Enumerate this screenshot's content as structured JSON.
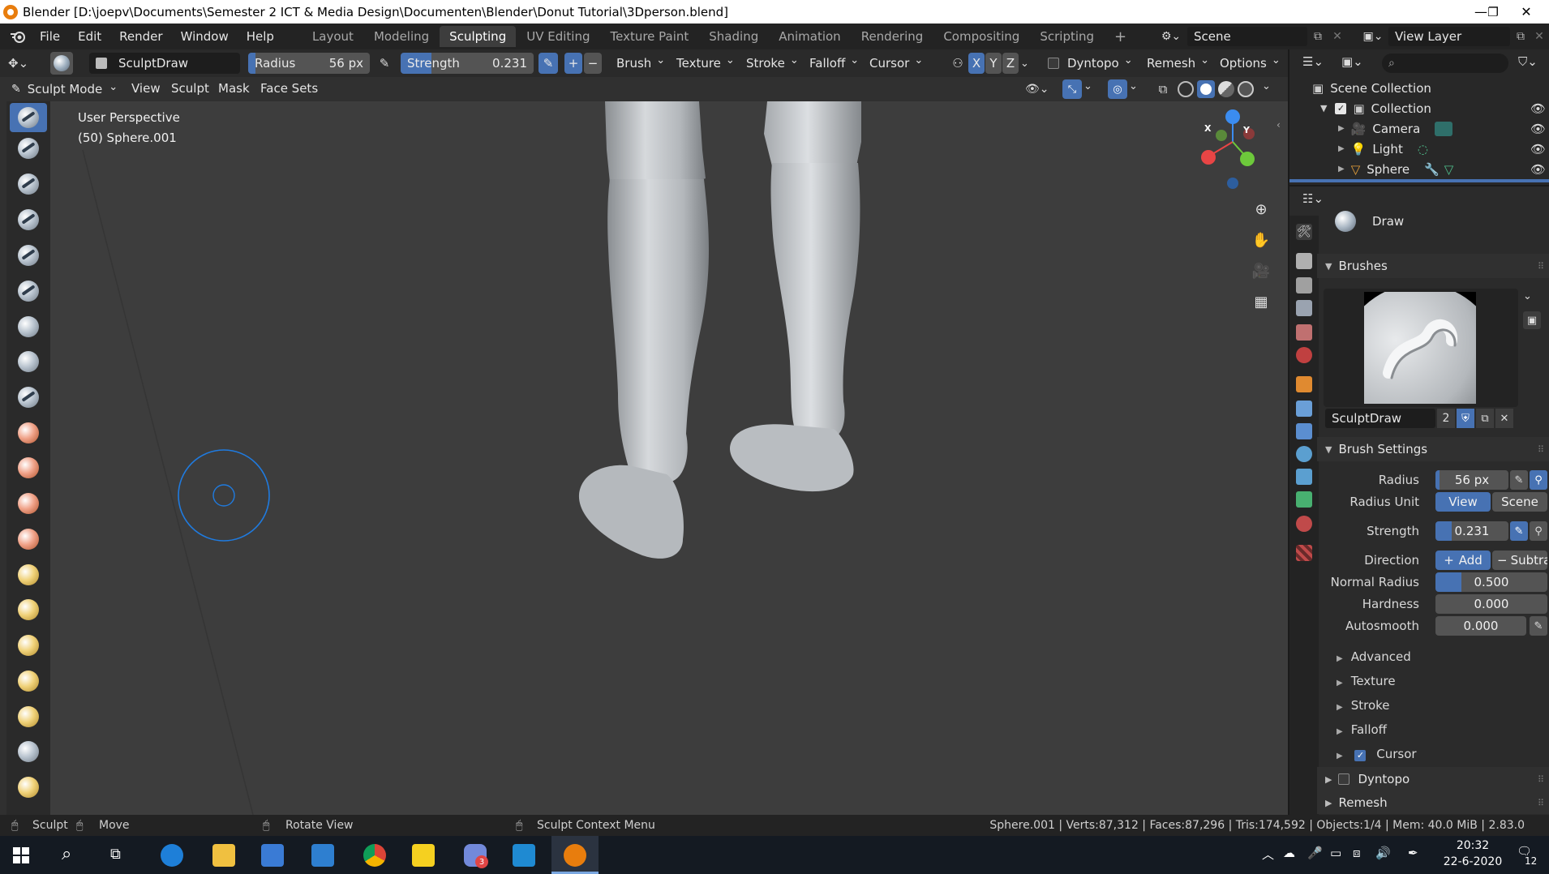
{
  "window": {
    "title": "Blender [D:\\joepv\\Documents\\Semester 2 ICT & Media Design\\Documenten\\Blender\\Donut Tutorial\\3Dperson.blend]",
    "minimize": "—",
    "maximize": "❐",
    "close": "✕"
  },
  "menu": [
    "File",
    "Edit",
    "Render",
    "Window",
    "Help"
  ],
  "workspaces": [
    "Layout",
    "Modeling",
    "Sculpting",
    "UV Editing",
    "Texture Paint",
    "Shading",
    "Animation",
    "Rendering",
    "Compositing",
    "Scripting"
  ],
  "active_workspace": "Sculpting",
  "add_workspace": "+",
  "scene": "Scene",
  "view_layer": "View Layer",
  "tool_header": {
    "brush_name": "SculptDraw",
    "radius_label": "Radius",
    "radius_value": "56 px",
    "strength_label": "Strength",
    "strength_value": "0.231",
    "add": "+",
    "subtract": "−",
    "brush": "Brush",
    "texture": "Texture",
    "stroke": "Stroke",
    "falloff": "Falloff",
    "cursor": "Cursor",
    "x": "X",
    "y": "Y",
    "z": "Z",
    "dyntopo": "Dyntopo",
    "remesh": "Remesh",
    "options": "Options"
  },
  "view_header": {
    "mode": "Sculpt Mode",
    "items": [
      "View",
      "Sculpt",
      "Mask",
      "Face Sets"
    ]
  },
  "viewport": {
    "perspective": "User Perspective",
    "object": "(50) Sphere.001",
    "gizmo_x": "X",
    "gizmo_y": "Y",
    "gizmo_z": "Z"
  },
  "outliner": {
    "root": "Scene Collection",
    "collection": "Collection",
    "items": [
      "Camera",
      "Light",
      "Sphere"
    ]
  },
  "properties": {
    "active_tool": "Draw",
    "brushes_header": "Brushes",
    "brush_name": "SculptDraw",
    "brush_users": "2",
    "brush_settings_header": "Brush Settings",
    "radius_label": "Radius",
    "radius_value": "56 px",
    "radius_unit_label": "Radius Unit",
    "radius_unit_view": "View",
    "radius_unit_scene": "Scene",
    "strength_label": "Strength",
    "strength_value": "0.231",
    "direction_label": "Direction",
    "direction_add": "Add",
    "direction_subtract": "Subtra",
    "normal_radius_label": "Normal Radius",
    "normal_radius_value": "0.500",
    "hardness_label": "Hardness",
    "hardness_value": "0.000",
    "autosmooth_label": "Autosmooth",
    "autosmooth_value": "0.000",
    "subpanels": [
      "Advanced",
      "Texture",
      "Stroke",
      "Falloff",
      "Cursor"
    ],
    "dyntopo_header": "Dyntopo",
    "remesh_header": "Remesh"
  },
  "statusbar": {
    "sculpt": "Sculpt",
    "move": "Move",
    "rotate_view": "Rotate View",
    "context_menu": "Sculpt Context Menu",
    "stats": "Sphere.001 | Verts:87,312 | Faces:87,296 | Tris:174,592 | Objects:1/4 | Mem: 40.0 MiB | 2.83.0"
  },
  "taskbar": {
    "time": "20:32",
    "date": "22-6-2020",
    "notifications": "12",
    "discord_badge": "3"
  },
  "colors": {
    "accent_blue": "#4772b3",
    "viewport_bg": "#3d3d3d",
    "brush_circle": "#1f7be0"
  }
}
